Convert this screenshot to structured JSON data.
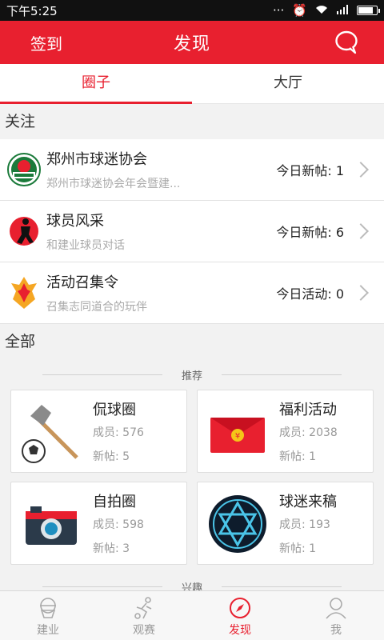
{
  "status": {
    "time": "下午5:25"
  },
  "header": {
    "left_label": "签到",
    "title": "发现"
  },
  "tabs": [
    {
      "label": "圈子"
    },
    {
      "label": "大厅"
    }
  ],
  "follow": {
    "title": "关注",
    "items": [
      {
        "name": "郑州市球迷协会",
        "sub": "郑州市球迷协会年会暨建...",
        "stat_label": "今日新帖:",
        "stat_value": "1"
      },
      {
        "name": "球员风采",
        "sub": "和建业球员对话",
        "stat_label": "今日新帖:",
        "stat_value": "6"
      },
      {
        "name": "活动召集令",
        "sub": "召集志同道合的玩伴",
        "stat_label": "今日活动:",
        "stat_value": "0"
      }
    ]
  },
  "all": {
    "title": "全部",
    "recommend_label": "推荐",
    "interest_label": "兴趣",
    "cards": [
      {
        "name": "侃球圈",
        "members_label": "成员:",
        "members": "576",
        "posts_label": "新帖:",
        "posts": "5"
      },
      {
        "name": "福利活动",
        "members_label": "成员:",
        "members": "2038",
        "posts_label": "新帖:",
        "posts": "1"
      },
      {
        "name": "自拍圈",
        "members_label": "成员:",
        "members": "598",
        "posts_label": "新帖:",
        "posts": "3"
      },
      {
        "name": "球迷来稿",
        "members_label": "成员:",
        "members": "193",
        "posts_label": "新帖:",
        "posts": "1"
      }
    ]
  },
  "nav": [
    {
      "label": "建业",
      "icon": "team-icon"
    },
    {
      "label": "观赛",
      "icon": "player-icon"
    },
    {
      "label": "发现",
      "icon": "compass-icon"
    },
    {
      "label": "我",
      "icon": "person-icon"
    }
  ],
  "colors": {
    "accent": "#e8202f"
  }
}
